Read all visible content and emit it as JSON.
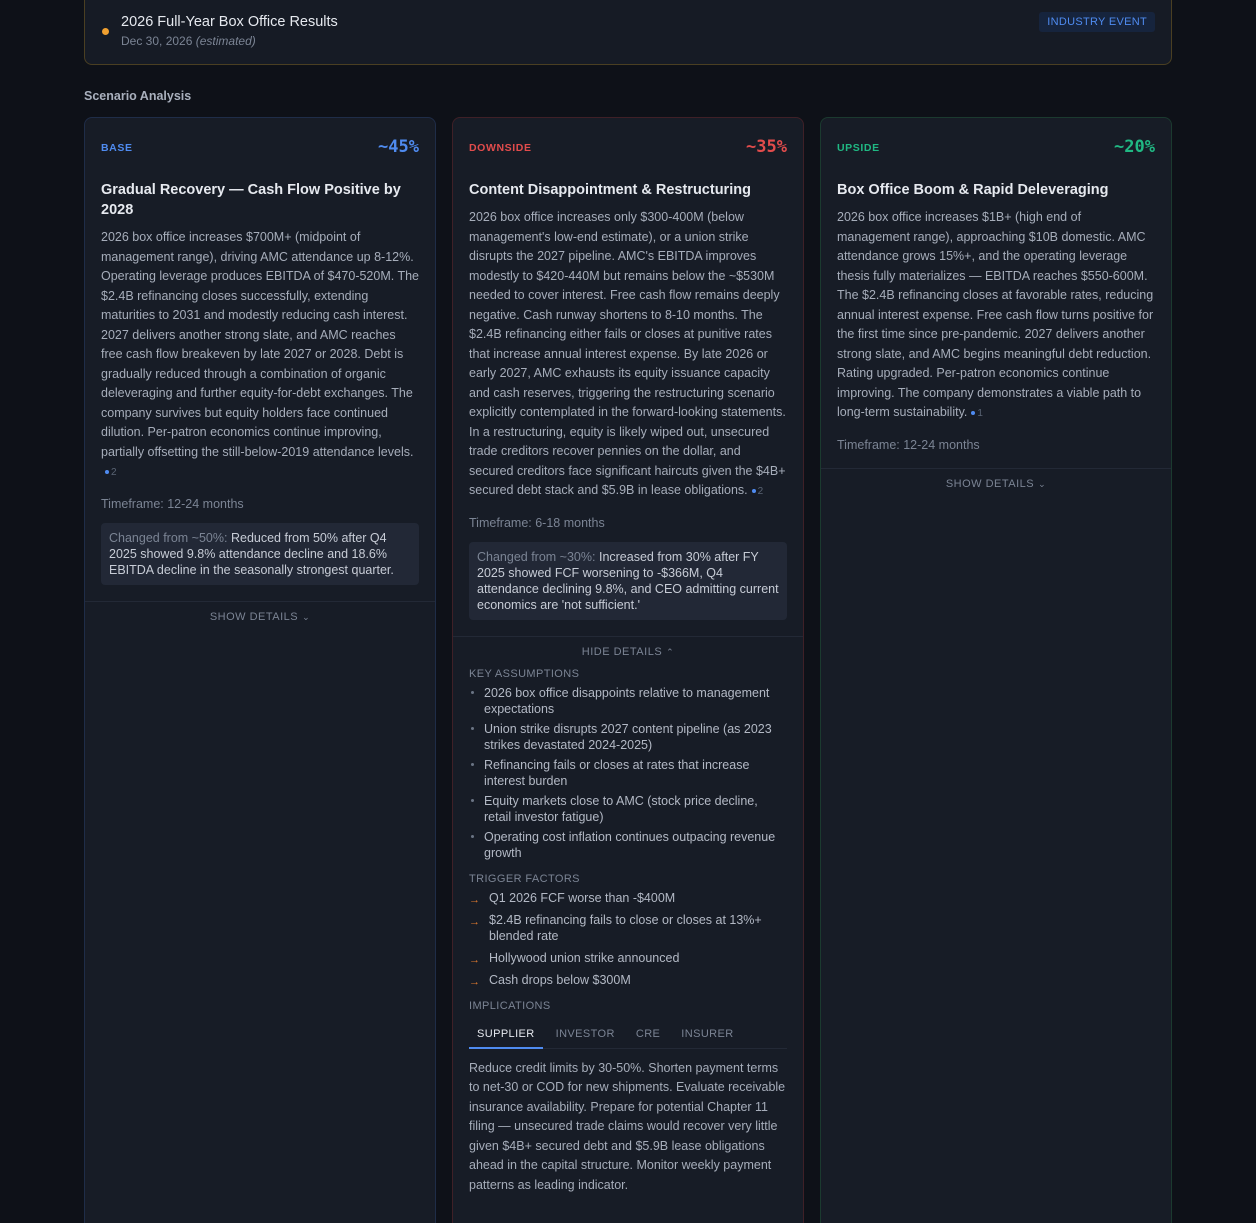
{
  "event": {
    "title": "2026 Full-Year Box Office Results",
    "date": "Dec 30, 2026",
    "date_note": "(estimated)",
    "tag": "INDUSTRY EVENT"
  },
  "section_title": "Scenario Analysis",
  "scenarios": [
    {
      "kind": "BASE",
      "probability": "~45%",
      "title": "Gradual Recovery — Cash Flow Positive by 2028",
      "description": "2026 box office increases $700M+ (midpoint of management range), driving AMC attendance up 8-12%. Operating leverage produces EBITDA of $470-520M. The $2.4B refinancing closes successfully, extending maturities to 2031 and modestly reducing cash interest. 2027 delivers another strong slate, and AMC reaches free cash flow breakeven by late 2027 or 2028. Debt is gradually reduced through a combination of organic deleveraging and further equity-for-debt exchanges. The company survives but equity holders face continued dilution. Per-patron economics continue improving, partially offsetting the still-below-2019 attendance levels.",
      "sources": "2",
      "timeframe": "Timeframe: 12-24 months",
      "changed_prefix": "Changed from ~50%:",
      "changed_text": "Reduced from 50% after Q4 2025 showed 9.8% attendance decline and 18.6% EBITDA decline in the seasonally strongest quarter.",
      "toggle": "SHOW DETAILS"
    },
    {
      "kind": "DOWNSIDE",
      "probability": "~35%",
      "title": "Content Disappointment & Restructuring",
      "description": "2026 box office increases only $300-400M (below management's low-end estimate), or a union strike disrupts the 2027 pipeline. AMC's EBITDA improves modestly to $420-440M but remains below the ~$530M needed to cover interest. Free cash flow remains deeply negative. Cash runway shortens to 8-10 months. The $2.4B refinancing either fails or closes at punitive rates that increase annual interest expense. By late 2026 or early 2027, AMC exhausts its equity issuance capacity and cash reserves, triggering the restructuring scenario explicitly contemplated in the forward-looking statements. In a restructuring, equity is likely wiped out, unsecured trade creditors recover pennies on the dollar, and secured creditors face significant haircuts given the $4B+ secured debt stack and $5.9B in lease obligations.",
      "sources": "2",
      "timeframe": "Timeframe: 6-18 months",
      "changed_prefix": "Changed from ~30%:",
      "changed_text": "Increased from 30% after FY 2025 showed FCF worsening to -$366M, Q4 attendance declining 9.8%, and CEO admitting current economics are 'not sufficient.'",
      "toggle": "HIDE DETAILS",
      "key_assumptions_label": "KEY ASSUMPTIONS",
      "key_assumptions": [
        "2026 box office disappoints relative to management expectations",
        "Union strike disrupts 2027 content pipeline (as 2023 strikes devastated 2024-2025)",
        "Refinancing fails or closes at rates that increase interest burden",
        "Equity markets close to AMC (stock price decline, retail investor fatigue)",
        "Operating cost inflation continues outpacing revenue growth"
      ],
      "trigger_factors_label": "TRIGGER FACTORS",
      "trigger_factors": [
        "Q1 2026 FCF worse than -$400M",
        "$2.4B refinancing fails to close or closes at 13%+ blended rate",
        "Hollywood union strike announced",
        "Cash drops below $300M"
      ],
      "implications_label": "IMPLICATIONS",
      "implication_tabs": [
        "SUPPLIER",
        "INVESTOR",
        "CRE",
        "INSURER"
      ],
      "implication_text": "Reduce credit limits by 30-50%. Shorten payment terms to net-30 or COD for new shipments. Evaluate receivable insurance availability. Prepare for potential Chapter 11 filing — unsecured trade claims would recover very little given $4B+ secured debt and $5.9B lease obligations ahead in the capital structure. Monitor weekly payment patterns as leading indicator."
    },
    {
      "kind": "UPSIDE",
      "probability": "~20%",
      "title": "Box Office Boom & Rapid Deleveraging",
      "description": "2026 box office increases $1B+ (high end of management range), approaching $10B domestic. AMC attendance grows 15%+, and the operating leverage thesis fully materializes — EBITDA reaches $550-600M. The $2.4B refinancing closes at favorable rates, reducing annual interest expense. Free cash flow turns positive for the first time since pre-pandemic. 2027 delivers another strong slate, and AMC begins meaningful debt reduction. Rating upgraded. Per-patron economics continue improving. The company demonstrates a viable path to long-term sustainability.",
      "sources": "1",
      "timeframe": "Timeframe: 12-24 months",
      "toggle": "SHOW DETAILS"
    }
  ]
}
